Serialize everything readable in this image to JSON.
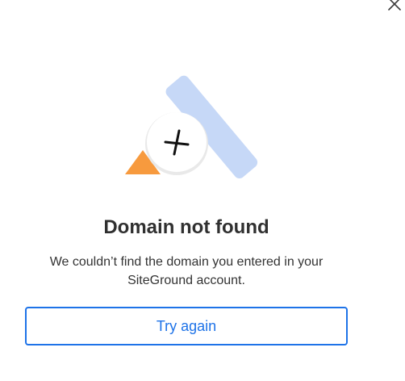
{
  "dialog": {
    "title": "Domain not found",
    "message": "We couldn’t find the domain you entered in your SiteGround account.",
    "primary_button_label": "Try again",
    "close_icon": "close-icon"
  },
  "illustration": {
    "icons": [
      "orange-triangle-shape",
      "blue-bar-shape",
      "cross-circle-icon"
    ],
    "colors": {
      "triangle": "#f79a3e",
      "bar": "#c6d8f7",
      "circle_fill": "#ffffff",
      "circle_shadow": "#e9e9e9",
      "cross": "#111111"
    }
  },
  "colors": {
    "accent": "#1e73e8",
    "text": "#303030"
  }
}
